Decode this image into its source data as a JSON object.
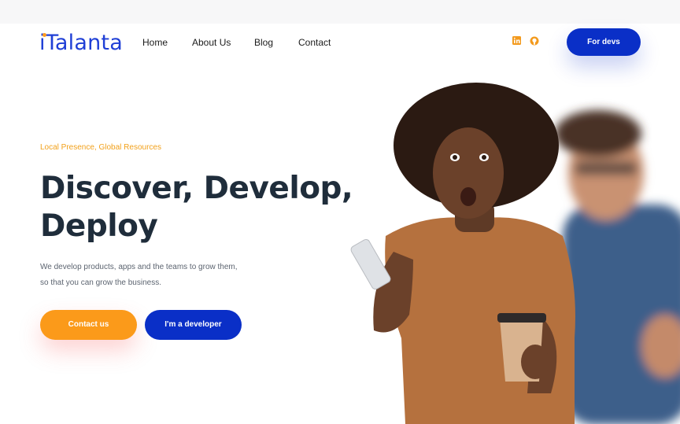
{
  "brand": {
    "logo_text": "iTalanta",
    "accent": "#f39a1d",
    "primary": "#0a2fc7"
  },
  "nav": {
    "items": [
      "Home",
      "About Us",
      "Blog",
      "Contact"
    ]
  },
  "social": {
    "icons": [
      "linkedin-icon",
      "github-icon"
    ]
  },
  "header": {
    "cta_label": "For devs"
  },
  "hero": {
    "tagline": "Local Presence, Global Resources",
    "headline_line1": "Discover, Develop,",
    "headline_line2": "Deploy",
    "sub_line1": "We develop products, apps and the teams to grow them,",
    "sub_line2": "so that you can grow the business.",
    "primary_button": "Contact us",
    "secondary_button": "I'm a developer"
  }
}
